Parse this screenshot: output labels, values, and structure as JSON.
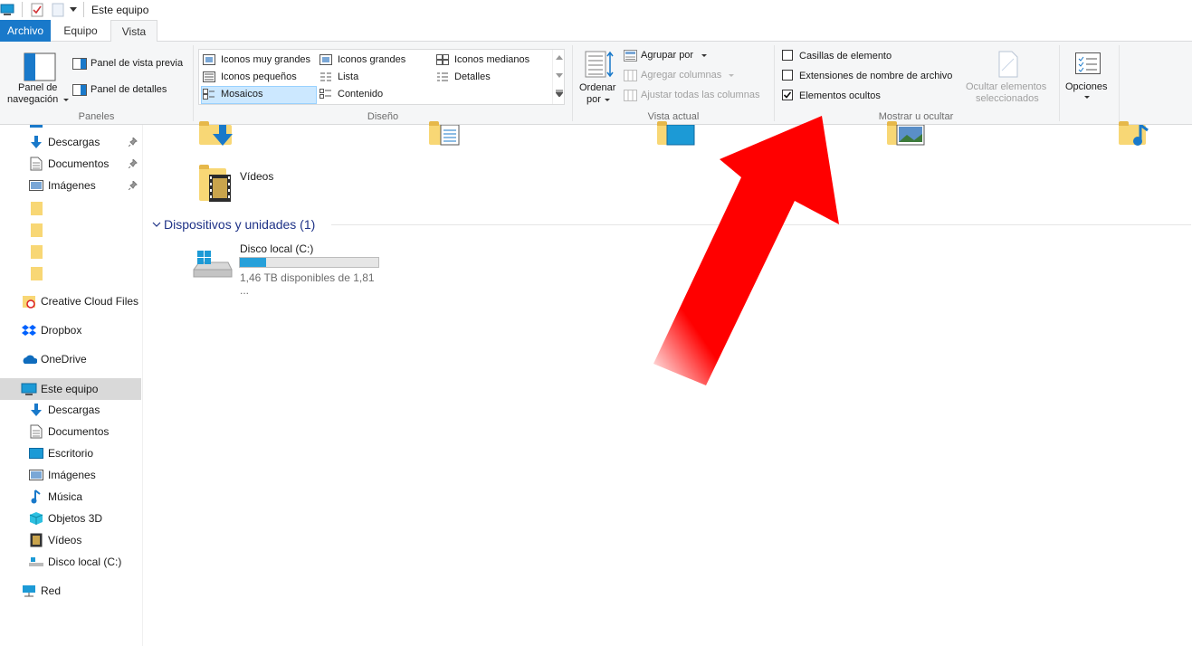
{
  "window": {
    "title": "Este equipo"
  },
  "tabs": [
    {
      "label": "Archivo"
    },
    {
      "label": "Equipo"
    },
    {
      "label": "Vista"
    }
  ],
  "ribbon": {
    "paneles": {
      "nav_pane_line1": "Panel de",
      "nav_pane_line2": "navegación",
      "preview_pane": "Panel de vista previa",
      "details_pane": "Panel de detalles",
      "group_label": "Paneles"
    },
    "diseno": {
      "items": [
        "Iconos muy grandes",
        "Iconos grandes",
        "Iconos medianos",
        "Iconos pequeños",
        "Lista",
        "Detalles",
        "Mosaicos",
        "Contenido"
      ],
      "selected": "Mosaicos",
      "group_label": "Diseño"
    },
    "vista_actual": {
      "sort_line1": "Ordenar",
      "sort_line2": "por",
      "group_by": "Agrupar por",
      "add_columns": "Agregar columnas",
      "fit_columns": "Ajustar todas las columnas",
      "group_label": "Vista actual"
    },
    "mostrar": {
      "checkboxes": [
        {
          "label": "Casillas de elemento",
          "checked": false
        },
        {
          "label": "Extensiones de nombre de archivo",
          "checked": false
        },
        {
          "label": "Elementos ocultos",
          "checked": true
        }
      ],
      "hide_selected_line1": "Ocultar elementos",
      "hide_selected_line2": "seleccionados",
      "group_label": "Mostrar u ocultar"
    },
    "opciones": {
      "label": "Opciones"
    }
  },
  "nav": {
    "quick_access": [
      {
        "label": "Descargas",
        "pinned": true
      },
      {
        "label": "Documentos",
        "pinned": true
      },
      {
        "label": "Imágenes",
        "pinned": true
      }
    ],
    "creative_cloud": "Creative Cloud Files",
    "dropbox": "Dropbox",
    "onedrive": "OneDrive",
    "this_pc": "Este equipo",
    "this_pc_children": [
      "Descargas",
      "Documentos",
      "Escritorio",
      "Imágenes",
      "Música",
      "Objetos 3D",
      "Vídeos",
      "Disco local (C:)"
    ],
    "network": "Red"
  },
  "content": {
    "videos_label": "Vídeos",
    "devices_header": "Dispositivos y unidades (1)",
    "drive": {
      "name": "Disco local (C:)",
      "space": "1,46 TB disponibles de 1,81 ...",
      "used_fraction": 0.19
    }
  },
  "colors": {
    "accent": "#1979ca",
    "selection": "#cce8ff",
    "arrow": "#ff0000",
    "drive_bar": "#26a0da"
  }
}
